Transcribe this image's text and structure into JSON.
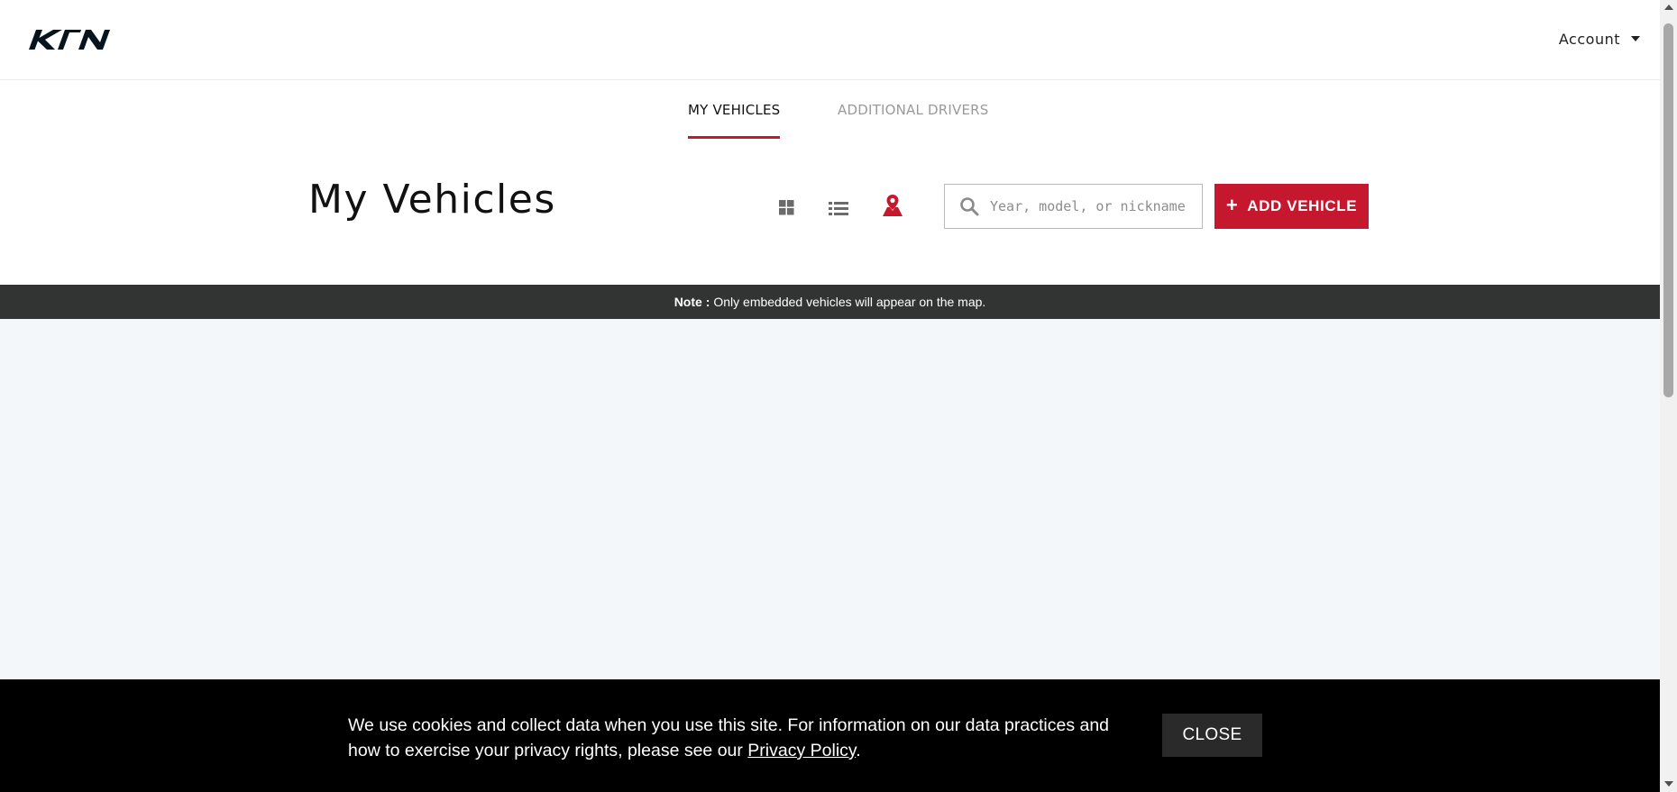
{
  "header": {
    "logo_alt": "KIA",
    "account_label": "Account"
  },
  "tabs": [
    {
      "label": "MY VEHICLES",
      "active": true
    },
    {
      "label": "ADDITIONAL DRIVERS",
      "active": false
    }
  ],
  "main": {
    "title": "My Vehicles",
    "views": [
      {
        "icon": "grid-view-icon",
        "active": false
      },
      {
        "icon": "list-view-icon",
        "active": false
      },
      {
        "icon": "map-pin-icon",
        "active": true
      }
    ],
    "search": {
      "placeholder": "Year, model, or nickname",
      "value": ""
    },
    "add_button": {
      "plus": "+",
      "label": "ADD VEHICLE"
    }
  },
  "note": {
    "prefix": "Note :",
    "text": "Only embedded vehicles will appear on the map."
  },
  "cookie_banner": {
    "text": "We use cookies and collect data when you use this site. For information on our data practices and how to exercise your privacy rights, please see our ",
    "link_text": "Privacy Policy",
    "suffix": ".",
    "close_label": "CLOSE"
  },
  "colors": {
    "brand_red": "#c5182e",
    "note_bar": "#323333",
    "map_bg": "#f4f7f9",
    "cookie_bg": "#000000"
  }
}
